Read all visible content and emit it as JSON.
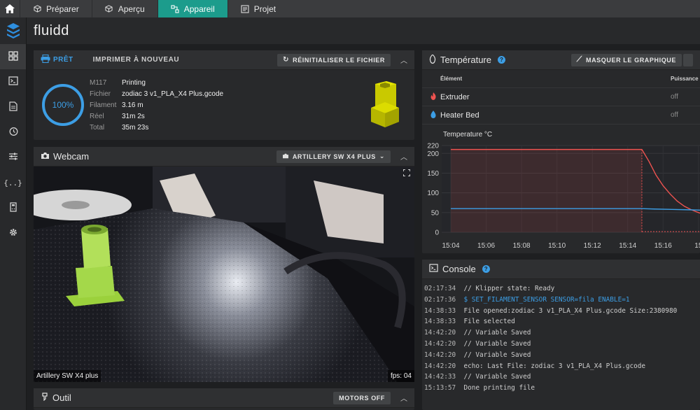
{
  "tabs": [
    {
      "label": "Préparer",
      "active": false
    },
    {
      "label": "Aperçu",
      "active": false
    },
    {
      "label": "Appareil",
      "active": true
    },
    {
      "label": "Projet",
      "active": false
    }
  ],
  "app": {
    "title": "fluidd"
  },
  "colors": {
    "accent": "#1c9c8c",
    "blue": "#3c9ee5",
    "red": "#ef5350",
    "model": "#d8d800"
  },
  "status": {
    "state": "PRÊT",
    "reprint_label": "IMPRIMER À NOUVEAU",
    "reset_button": "RÉINITIALISER LE FICHIER",
    "progress_text": "100%",
    "progress": 1.0,
    "rows": [
      {
        "k": "M117",
        "v": "Printing"
      },
      {
        "k": "Fichier",
        "v": "zodiac 3 v1_PLA_X4 Plus.gcode"
      },
      {
        "k": "Filament",
        "v": "3.16 m"
      },
      {
        "k": "Réel",
        "v": "31m 2s"
      },
      {
        "k": "Total",
        "v": "35m 23s"
      }
    ]
  },
  "webcam": {
    "title": "Webcam",
    "camera_select": "ARTILLERY SW X4 PLUS",
    "name_tag": "Artillery SW X4 plus",
    "fps": "fps: 04"
  },
  "tool": {
    "title": "Outil",
    "motors_button": "MOTORS OFF"
  },
  "temperature": {
    "title": "Température",
    "hide_chart_button": "MASQUER LE GRAPHIQUE",
    "col_element": "Élément",
    "col_power": "Puissance",
    "heaters": [
      {
        "name": "Extruder",
        "power": "off",
        "icon": "fire-icon"
      },
      {
        "name": "Heater Bed",
        "power": "off",
        "icon": "drop-icon"
      }
    ]
  },
  "chart_data": {
    "type": "line",
    "title": "Temperature °C",
    "ylim": [
      0,
      220
    ],
    "yticks": [
      "220",
      "200",
      "150",
      "100",
      "50",
      "0"
    ],
    "xticks": [
      "15:04",
      "15:06",
      "15:08",
      "15:10",
      "15:12",
      "15:14",
      "15:16",
      "15"
    ],
    "series": [
      {
        "values": [
          [
            0,
            210
          ],
          [
            10.8,
            210
          ],
          [
            11.2,
            180
          ],
          [
            11.6,
            145
          ],
          [
            12.0,
            118
          ],
          [
            12.4,
            97
          ],
          [
            12.8,
            79
          ],
          [
            13.2,
            66
          ],
          [
            13.6,
            57
          ],
          [
            14.0,
            50
          ],
          [
            14.3,
            45
          ]
        ],
        "color": "#ef5350"
      },
      {
        "values": [
          [
            0,
            60
          ],
          [
            10.8,
            60
          ],
          [
            11.5,
            59
          ],
          [
            12.5,
            58
          ],
          [
            13.5,
            57
          ],
          [
            14.3,
            56
          ]
        ],
        "color": "#3c9ee5"
      }
    ]
  },
  "console": {
    "title": "Console",
    "lines": [
      {
        "ts": "02:17:34",
        "msg": "// Klipper state: Ready",
        "cmd": false
      },
      {
        "ts": "02:17:36",
        "msg": "$ SET_FILAMENT_SENSOR SENSOR=fila ENABLE=1",
        "cmd": true
      },
      {
        "ts": "14:38:33",
        "msg": "File opened:zodiac 3 v1_PLA_X4 Plus.gcode Size:2380980",
        "cmd": false
      },
      {
        "ts": "14:38:33",
        "msg": "File selected",
        "cmd": false
      },
      {
        "ts": "14:42:20",
        "msg": "// Variable Saved",
        "cmd": false
      },
      {
        "ts": "14:42:20",
        "msg": "// Variable Saved",
        "cmd": false
      },
      {
        "ts": "14:42:20",
        "msg": "// Variable Saved",
        "cmd": false
      },
      {
        "ts": "14:42:20",
        "msg": "echo: Last File: zodiac 3 v1_PLA_X4 Plus.gcode",
        "cmd": false
      },
      {
        "ts": "14:42:33",
        "msg": "// Variable Saved",
        "cmd": false
      },
      {
        "ts": "15:13:57",
        "msg": "Done printing file",
        "cmd": false
      }
    ]
  }
}
